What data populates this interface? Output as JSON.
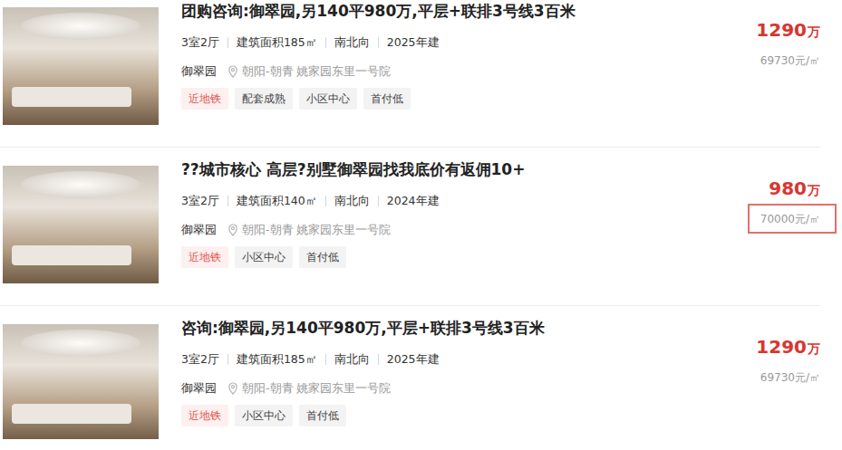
{
  "listings": [
    {
      "title": "团购咨询:御翠园,另140平980万,平层+联排3号线3百米",
      "details": [
        "3室2厅",
        "建筑面积185㎡",
        "南北向",
        "2025年建"
      ],
      "community": "御翠园",
      "location": "朝阳-朝青 姚家园东里一号院",
      "tags": [
        {
          "label": "近地铁",
          "highlight": true
        },
        {
          "label": "配套成熟",
          "highlight": false
        },
        {
          "label": "小区中心",
          "highlight": false
        },
        {
          "label": "首付低",
          "highlight": false
        }
      ],
      "price": "1290",
      "price_unit": "万",
      "unit_price": "69730元/㎡",
      "unit_price_marked": false
    },
    {
      "title": "??城市核心 高层?别墅御翠园找我底价有返佣10+",
      "details": [
        "3室2厅",
        "建筑面积140㎡",
        "南北向",
        "2024年建"
      ],
      "community": "御翠园",
      "location": "朝阳-朝青 姚家园东里一号院",
      "tags": [
        {
          "label": "近地铁",
          "highlight": true
        },
        {
          "label": "小区中心",
          "highlight": false
        },
        {
          "label": "首付低",
          "highlight": false
        }
      ],
      "price": "980",
      "price_unit": "万",
      "unit_price": "70000元/㎡",
      "unit_price_marked": true
    },
    {
      "title": "咨询:御翠园,另140平980万,平层+联排3号线3百米",
      "details": [
        "3室2厅",
        "建筑面积185㎡",
        "南北向",
        "2025年建"
      ],
      "community": "御翠园",
      "location": "朝阳-朝青 姚家园东里一号院",
      "tags": [
        {
          "label": "近地铁",
          "highlight": true
        },
        {
          "label": "小区中心",
          "highlight": false
        },
        {
          "label": "首付低",
          "highlight": false
        }
      ],
      "price": "1290",
      "price_unit": "万",
      "unit_price": "69730元/㎡",
      "unit_price_marked": false
    }
  ]
}
